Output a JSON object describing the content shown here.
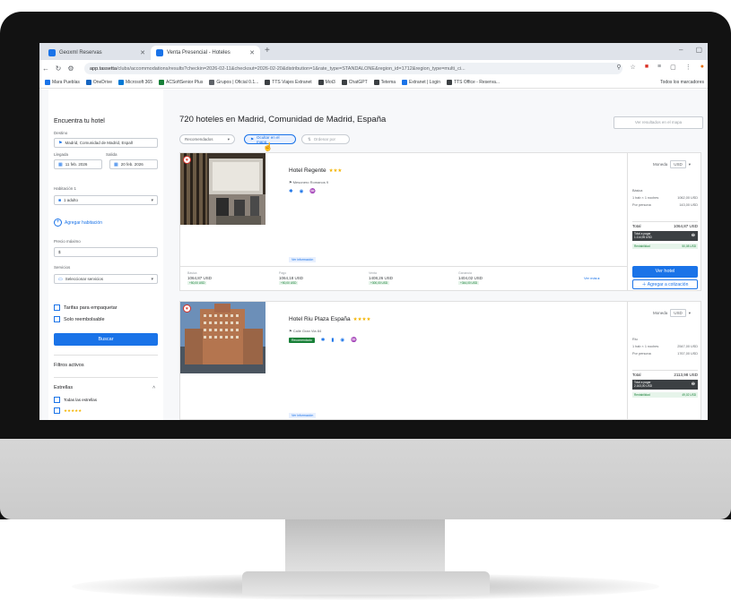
{
  "browser": {
    "tabs": [
      {
        "label": "Geoxml Reservas",
        "favicon_color": "#1a73e8",
        "active": false
      },
      {
        "label": "Venta Presencial - Hoteles",
        "favicon_color": "#1a73e8",
        "active": true
      }
    ],
    "url_domain": "app.tassetta",
    "url_rest": "/clubs/accommodations/results?checkin=2026-02-11&checkout=2026-02-20&distribution=1&rate_type=STANDALONE&region_id=1712&region_type=multi_ci...",
    "bookmarks": [
      "Mara Pueblas",
      "OneDrive",
      "Microsoft 365",
      "ACSoftSenior Plus",
      "Grupos | Oficial 0.1...",
      "TTS Viajes Extranet",
      "Mot3",
      "ChatGPT",
      "Tetema",
      "Extranet | Login",
      "TTS Office - Reserva..."
    ],
    "bookmarks_right": "Todos los marcadores"
  },
  "sidebar": {
    "title": "Encuentra tu hotel",
    "destino_label": "Destino",
    "destino_value": "Madrid, Comunidad de Madrid, Españ",
    "llegada_label": "Llegada",
    "salida_label": "Salida",
    "llegada_value": "11 feb. 2026",
    "salida_value": "20 feb. 2026",
    "habitacion_label": "Habitación 1",
    "habitacion_value": "1 adulto",
    "add_room": "Agregar habitación",
    "precio_label": "Precio máximo",
    "precio_value": "$",
    "servicios_label": "Servicios",
    "servicios_value": "Seleccionar servicios",
    "check_empaquetar": "Tarifas para empaquetar",
    "check_reembolsable": "Solo reembolsable",
    "search_button": "Buscar",
    "filtros_activos": "Filtros activos",
    "estrellas": "Estrellas",
    "todas_estrellas": "Todas las estrellas",
    "five_stars": "★★★★★"
  },
  "results": {
    "title": "720 hoteles en Madrid, Comunidad de Madrid, España",
    "map_button": "Ver resultados en el mapa",
    "sort_value": "Recomendados",
    "chip_selected": "Ocultar en el mapa",
    "chip_plain": "Ordenar por",
    "hotels": [
      {
        "name": "Hotel Regente",
        "stars": "★★★",
        "address": "Mesonero Romanos 9",
        "badge": "",
        "link": "Ver información",
        "currency_label": "Moneda",
        "currency": "USD",
        "rows": [
          [
            "Básica",
            ""
          ],
          [
            "1 hab × 1 noches",
            "1062,00 USD"
          ],
          [
            "Por persona",
            "143,00 USD"
          ]
        ],
        "total_label": "Total",
        "total": "1064,87 USD",
        "pay_line1": "Total a pagar",
        "pay_line2": "1.114,95 USD",
        "rent_label": "Rentabilidad",
        "rent_value": "50,08 USD",
        "view_button": "Ver hotel",
        "compare_button": "Agregar a cotización",
        "projections": [
          {
            "label": "Básica",
            "value": "1064,87 USD",
            "tag": "+50,00 USD"
          },
          {
            "label": "Pago",
            "value": "1064,18 USD",
            "tag": "+50,00 USD"
          },
          {
            "label": "Venta",
            "value": "1408,26 USD",
            "tag": "+300,00 USD"
          },
          {
            "label": "Ganancia",
            "value": "1404,02 USD",
            "tag": "+344,00 USD"
          }
        ],
        "more": "Ver más ▸"
      },
      {
        "name": "Hotel Riu Plaza España",
        "stars": "★★★★",
        "address": "Calle Gran Via 84",
        "badge": "Recomendado",
        "link": "Ver información",
        "currency_label": "Moneda",
        "currency": "USD",
        "rows": [
          [
            "Riu",
            ""
          ],
          [
            "1 hab × 1 noches",
            "2547,00 USD"
          ],
          [
            "Por persona",
            "1767,00 USD"
          ]
        ],
        "total_label": "Total",
        "total": "2113,98 USD",
        "pay_line1": "Total a pagar",
        "pay_line2": "2.163,00 USD",
        "rent_label": "Rentabilidad",
        "rent_value": "49,02 USD",
        "view_button": "",
        "compare_button": "",
        "projections": [],
        "more": ""
      }
    ]
  },
  "colors": {
    "primary": "#1a73e8",
    "success": "#188038",
    "star": "#f4b400"
  }
}
